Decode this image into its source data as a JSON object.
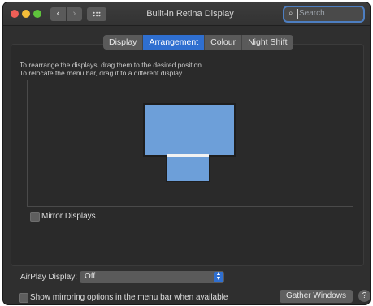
{
  "window": {
    "title": "Built-in Retina Display"
  },
  "titlebar": {
    "back_glyph": "‹",
    "forward_glyph": "›",
    "search_placeholder": "Search",
    "search_glyph": "⌕"
  },
  "tabs": [
    {
      "label": "Display",
      "active": false
    },
    {
      "label": "Arrangement",
      "active": true
    },
    {
      "label": "Colour",
      "active": false
    },
    {
      "label": "Night Shift",
      "active": false
    }
  ],
  "instructions": {
    "line1": "To rearrange the displays, drag them to the desired position.",
    "line2": "To relocate the menu bar, drag it to a different display."
  },
  "mirror": {
    "label": "Mirror Displays",
    "checked": false
  },
  "airplay": {
    "label": "AirPlay Display:",
    "value": "Off",
    "arrow_glyph": "⌃⌄"
  },
  "show_mirroring": {
    "label": "Show mirroring options in the menu bar when available",
    "checked": false
  },
  "buttons": {
    "gather": "Gather Windows",
    "help": "?"
  },
  "colors": {
    "accent": "#2f6fd0",
    "display_fill": "#6d9fd9",
    "window_bg": "#2f2f2f"
  }
}
